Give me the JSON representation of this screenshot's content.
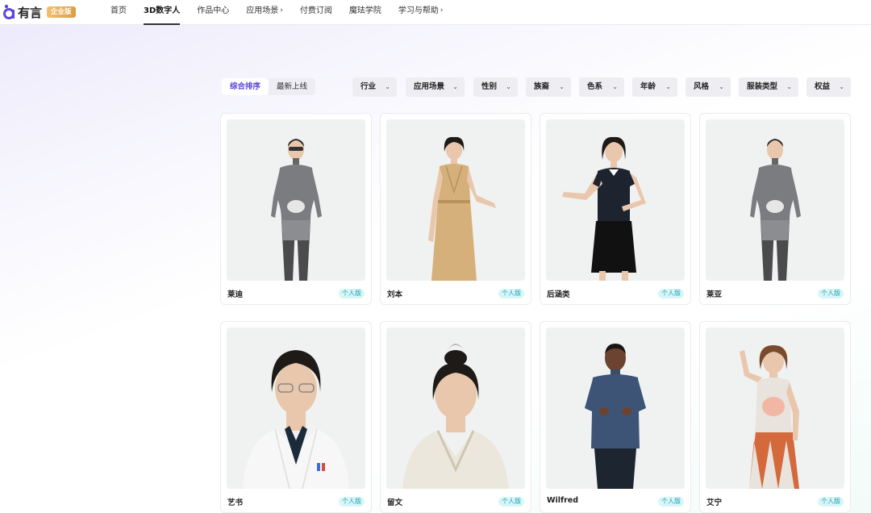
{
  "brand": {
    "name": "有言",
    "badge": "企业版"
  },
  "nav": {
    "items": [
      {
        "label": "首页",
        "chevron": false,
        "active": false
      },
      {
        "label": "3D数字人",
        "chevron": false,
        "active": true
      },
      {
        "label": "作品中心",
        "chevron": false,
        "active": false
      },
      {
        "label": "应用场景",
        "chevron": true,
        "active": false
      },
      {
        "label": "付费订阅",
        "chevron": false,
        "active": false
      },
      {
        "label": "魔珐学院",
        "chevron": false,
        "active": false
      },
      {
        "label": "学习与帮助",
        "chevron": true,
        "active": false
      }
    ]
  },
  "sort": {
    "options": [
      "综合排序",
      "最新上线"
    ],
    "selected": "综合排序"
  },
  "filters": [
    "行业",
    "应用场景",
    "性别",
    "族裔",
    "色系",
    "年龄",
    "风格",
    "服装类型",
    "权益"
  ],
  "avatars": [
    {
      "name": "莱迪",
      "tag": "个人版"
    },
    {
      "name": "刘本",
      "tag": "个人版"
    },
    {
      "name": "后涵类",
      "tag": "个人版"
    },
    {
      "name": "莱亚",
      "tag": "个人版"
    },
    {
      "name": "艺书",
      "tag": "个人版"
    },
    {
      "name": "留文",
      "tag": "个人版"
    },
    {
      "name": "Wilfred",
      "tag": "个人版"
    },
    {
      "name": "艾宁",
      "tag": "个人版"
    }
  ],
  "colors": {
    "accent": "#5b48d8",
    "tag_text": "#1a9fb0",
    "tag_bg": "#d8f6f7",
    "badge": "#e0a24a"
  }
}
